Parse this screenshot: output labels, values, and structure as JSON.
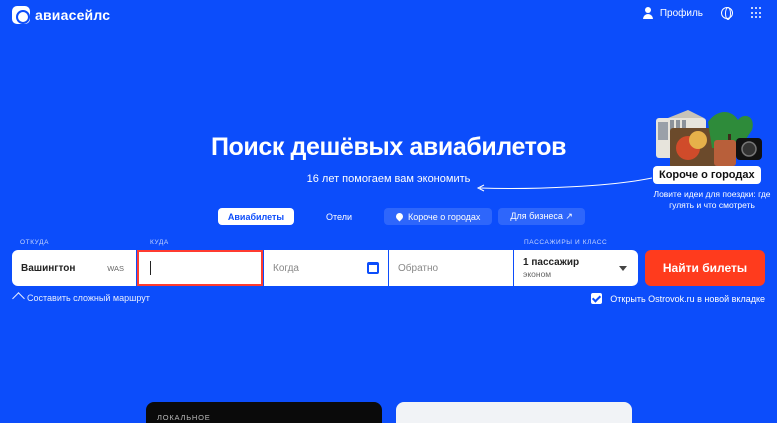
{
  "header": {
    "logo_text": "авиасейлс",
    "profile_label": "Профиль",
    "icons": [
      "person-icon",
      "globe-icon",
      "apps-grid-icon"
    ]
  },
  "hero": {
    "title": "Поиск дешёвых авиабилетов",
    "subtitle": "16 лет помогаем вам экономить"
  },
  "tabs": [
    {
      "label": "Авиабилеты",
      "active": true
    },
    {
      "label": "Отели",
      "active": false
    },
    {
      "label": "Короче о городах",
      "active": false,
      "icon": "pin-icon"
    },
    {
      "label": "Для бизнеса ↗",
      "active": false
    }
  ],
  "promo": {
    "title": "Короче о городах",
    "description": "Ловите идеи для поездки: где гулять и что смотреть"
  },
  "form": {
    "labels": {
      "from": "ОТКУДА",
      "to": "КУДА",
      "passengers": "ПАССАЖИРЫ И КЛАСС"
    },
    "from": {
      "city": "Вашингтон",
      "code": "WAS"
    },
    "to": {
      "value": ""
    },
    "when": {
      "placeholder": "Когда"
    },
    "back": {
      "placeholder": "Обратно"
    },
    "passengers": {
      "count": "1 пассажир",
      "class": "эконом"
    },
    "search_button": "Найти билеты"
  },
  "options": {
    "complex_route": "Составить сложный маршрут",
    "ostrovok": "Открыть Ostrovok.ru в новой вкладке",
    "ostrovok_checked": true
  },
  "cards": {
    "dark_label": "ЛОКАЛЬНОЕ"
  },
  "colors": {
    "background": "#0c4dfb",
    "button": "#ff3b1d",
    "focus_border": "#ff3b30"
  }
}
